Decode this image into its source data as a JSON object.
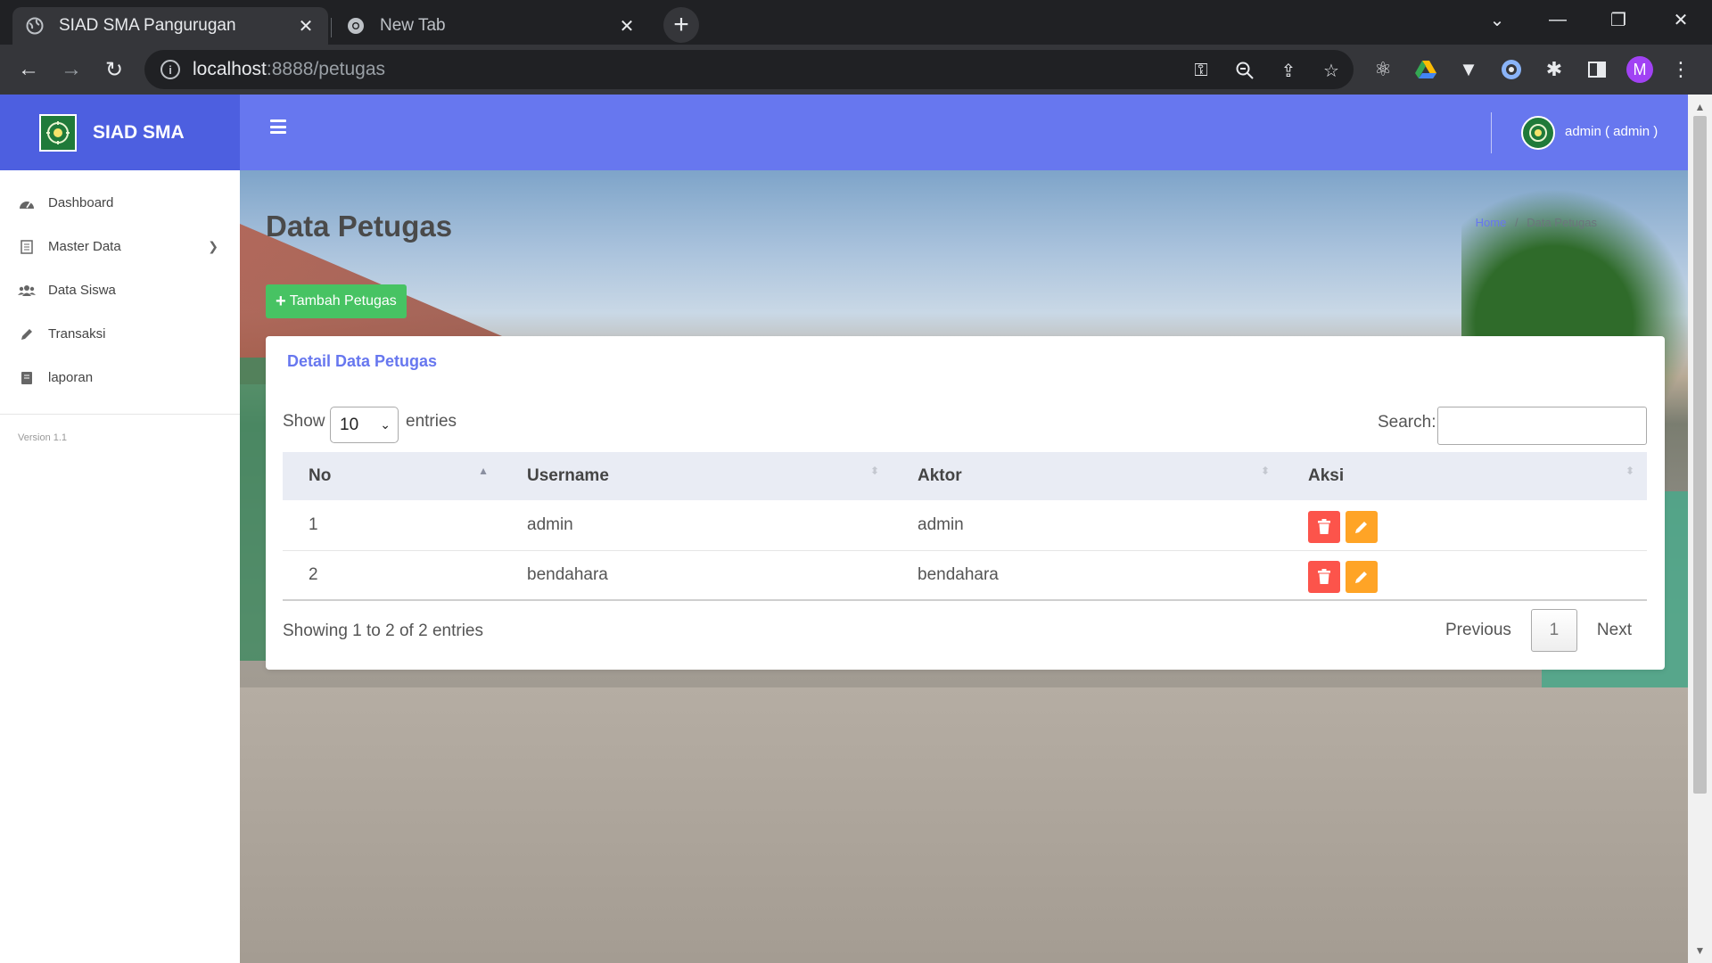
{
  "browser": {
    "tabs": [
      {
        "title": "SIAD SMA Pangurugan",
        "active": true
      },
      {
        "title": "New Tab",
        "active": false
      }
    ],
    "url_host": "localhost",
    "url_rest": ":8888/petugas",
    "profile_initial": "M"
  },
  "app": {
    "brand": "SIAD SMA",
    "user_label": "admin ( admin )",
    "accent_color": "#6777ef",
    "brand_color": "#4d5fe0"
  },
  "sidebar": {
    "items": [
      {
        "label": "Dashboard",
        "icon": "dashboard-icon"
      },
      {
        "label": "Master Data",
        "icon": "list-icon",
        "has_submenu": true
      },
      {
        "label": "Data Siswa",
        "icon": "users-icon"
      },
      {
        "label": "Transaksi",
        "icon": "pencil-icon"
      },
      {
        "label": "laporan",
        "icon": "book-icon"
      }
    ],
    "version": "Version 1.1"
  },
  "page": {
    "title": "Data Petugas",
    "breadcrumb": {
      "home": "Home",
      "separator": "/",
      "current": "Data Petugas"
    },
    "add_button": "Tambah Petugas"
  },
  "card": {
    "title": "Detail Data Petugas",
    "length": {
      "show": "Show",
      "value": "10",
      "suffix": "entries"
    },
    "search_label": "Search:",
    "search_value": "",
    "columns": [
      "No",
      "Username",
      "Aktor",
      "Aksi"
    ],
    "rows": [
      {
        "no": "1",
        "username": "admin",
        "aktor": "admin"
      },
      {
        "no": "2",
        "username": "bendahara",
        "aktor": "bendahara"
      }
    ],
    "info": "Showing 1 to 2 of 2 entries",
    "pager": {
      "previous": "Previous",
      "current": "1",
      "next": "Next"
    }
  }
}
